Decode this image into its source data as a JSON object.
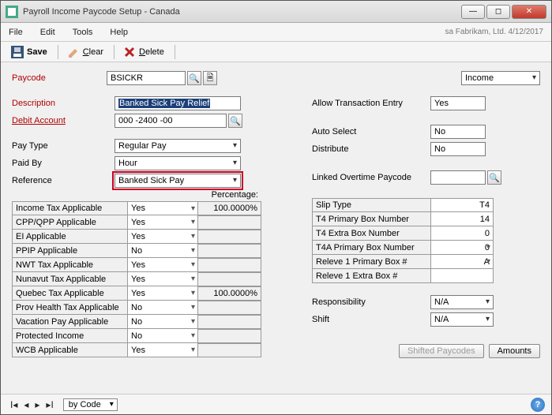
{
  "window": {
    "title": "Payroll Income Paycode Setup - Canada"
  },
  "menubar": {
    "file": "File",
    "edit": "Edit",
    "tools": "Tools",
    "help": "Help",
    "right_status": "sa Fabrikam, Ltd. 4/12/2017"
  },
  "toolbar": {
    "save": "Save",
    "clear": "Clear",
    "delete": "Delete",
    "clear_mn": "C",
    "delete_mn": "D"
  },
  "paycode": {
    "label": "Paycode",
    "value": "BSICKR",
    "type_label": "Income",
    "type_value": "Income"
  },
  "desc": {
    "label": "Description",
    "value": "Banked Sick Pay Relief"
  },
  "debit": {
    "label": "Debit Account",
    "value": "000 -2400 -00"
  },
  "paytype": {
    "label": "Pay Type",
    "value": "Regular Pay"
  },
  "paidby": {
    "label": "Paid By",
    "value": "Hour"
  },
  "reference": {
    "label": "Reference",
    "value": "Banked Sick Pay"
  },
  "pct_header": "Percentage:",
  "left_table": [
    {
      "label": "Income Tax Applicable",
      "value": "Yes",
      "pct": "100.0000%"
    },
    {
      "label": "CPP/QPP Applicable",
      "value": "Yes",
      "pct": ""
    },
    {
      "label": "EI Applicable",
      "value": "Yes",
      "pct": ""
    },
    {
      "label": "PPIP Applicable",
      "value": "No",
      "pct": ""
    },
    {
      "label": "NWT Tax Applicable",
      "value": "Yes",
      "pct": ""
    },
    {
      "label": "Nunavut Tax Applicable",
      "value": "Yes",
      "pct": ""
    },
    {
      "label": "Quebec Tax Applicable",
      "value": "Yes",
      "pct": "100.0000%"
    },
    {
      "label": "Prov Health Tax Applicable",
      "value": "No",
      "pct": ""
    },
    {
      "label": "Vacation Pay Applicable",
      "value": "No",
      "pct": ""
    },
    {
      "label": "Protected Income",
      "value": "No",
      "pct": ""
    },
    {
      "label": "WCB Applicable",
      "value": "Yes",
      "pct": ""
    }
  ],
  "right_top": {
    "allow_label": "Allow Transaction Entry",
    "allow_value": "Yes",
    "autoselect_label": "Auto Select",
    "autoselect_value": "No",
    "distribute_label": "Distribute",
    "distribute_value": "No",
    "linked_ot_label": "Linked Overtime Paycode",
    "linked_ot_value": ""
  },
  "right_grid": [
    {
      "label": "Slip Type",
      "value": "T4",
      "dd": false
    },
    {
      "label": "T4 Primary Box Number",
      "value": "14",
      "dd": false
    },
    {
      "label": "T4 Extra Box Number",
      "value": "0",
      "dd": false
    },
    {
      "label": "T4A Primary Box Number",
      "value": "0",
      "dd": true
    },
    {
      "label": "Releve 1 Primary Box #",
      "value": "A",
      "dd": true
    },
    {
      "label": "Releve 1 Extra Box #",
      "value": "",
      "dd": false
    }
  ],
  "resp": {
    "label": "Responsibility",
    "value": "N/A"
  },
  "shift": {
    "label": "Shift",
    "value": "N/A"
  },
  "buttons": {
    "shifted": "Shifted Paycodes",
    "amounts": "Amounts"
  },
  "nav": {
    "sort": "by Code"
  }
}
